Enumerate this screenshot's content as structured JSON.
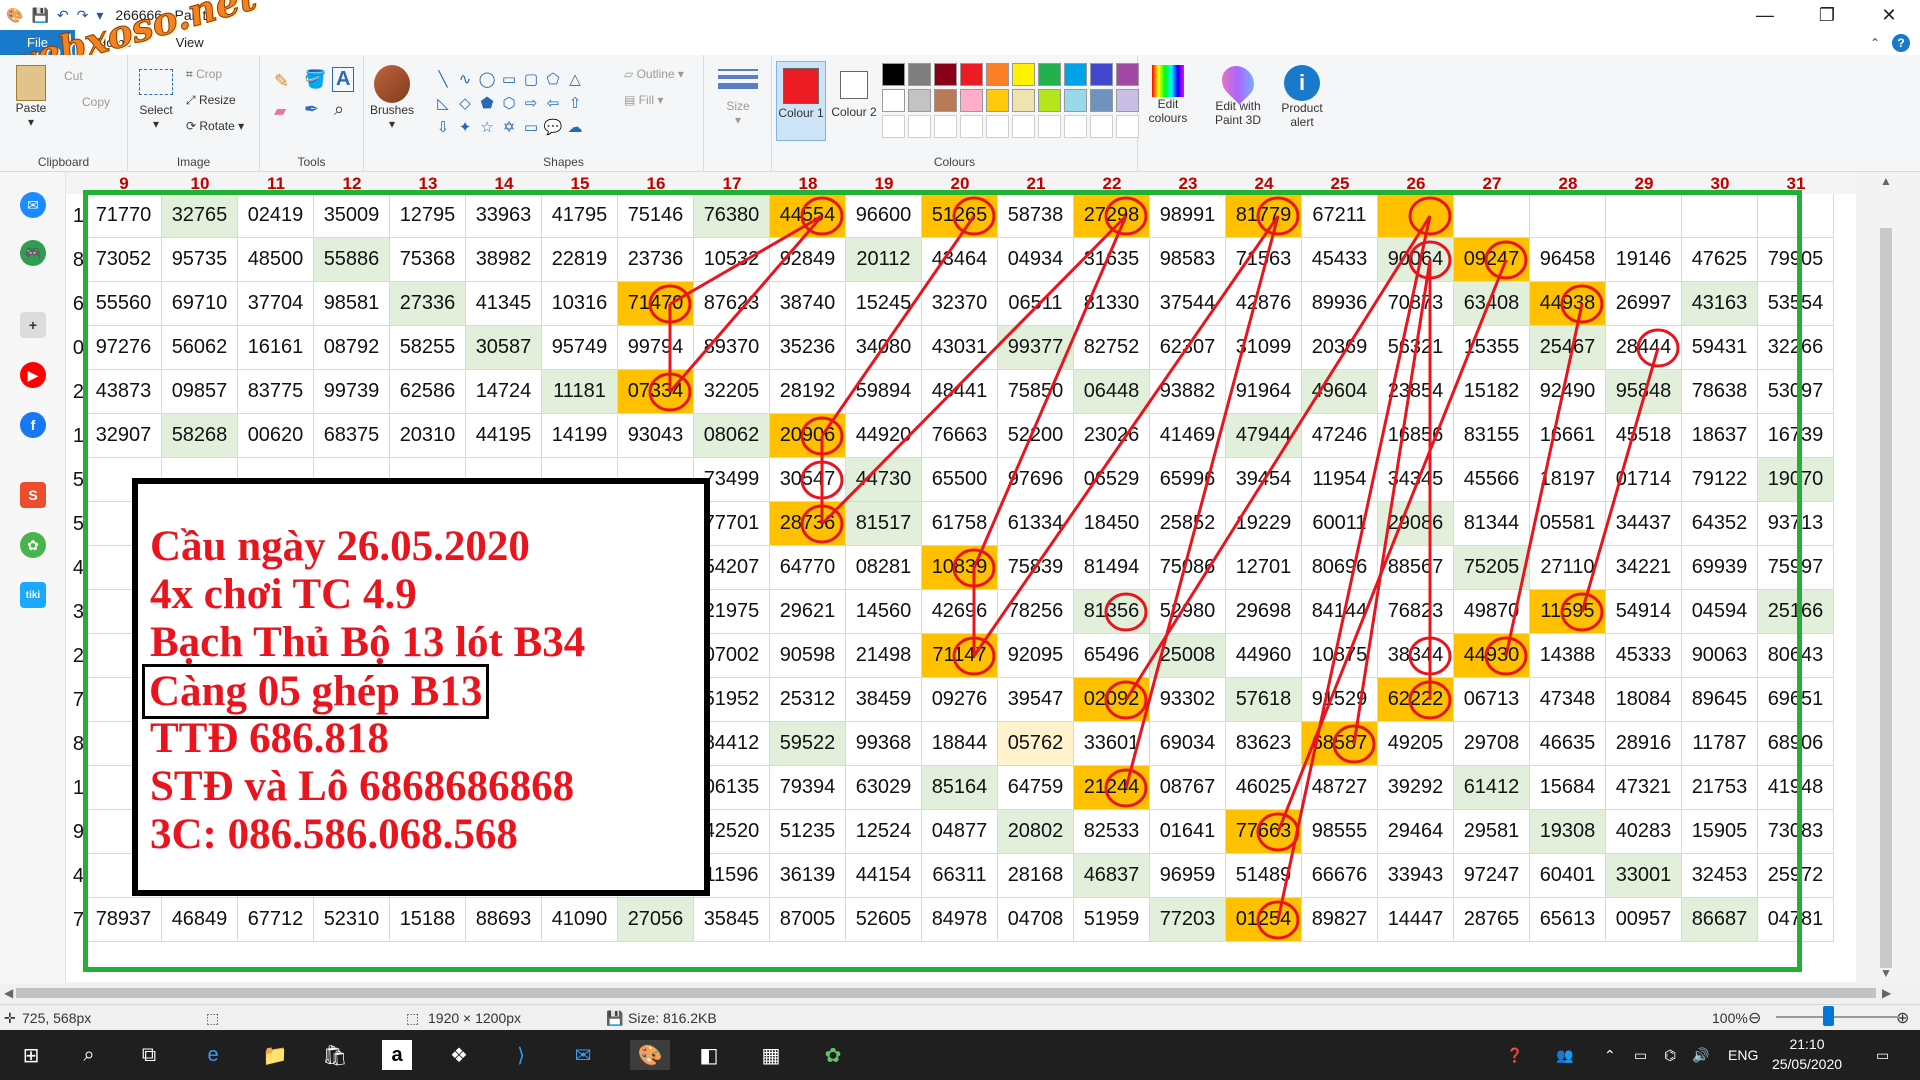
{
  "window": {
    "title": "266666 - Paint",
    "controls": [
      "—",
      "❐",
      "✕"
    ]
  },
  "tabs": [
    {
      "label": "File"
    },
    {
      "label": "Home"
    },
    {
      "label": "View"
    }
  ],
  "ribbon": {
    "clipboard": {
      "paste": "Paste",
      "cut": "Cut",
      "copy": "Copy",
      "label": "Clipboard"
    },
    "image": {
      "select": "Select",
      "crop": "Crop",
      "resize": "Resize",
      "rotate": "Rotate",
      "label": "Image"
    },
    "tools": {
      "label": "Tools"
    },
    "brushes": "Brushes",
    "shapes": {
      "outline": "Outline",
      "fill": "Fill",
      "label": "Shapes"
    },
    "size": "Size",
    "colour1": "Colour 1",
    "colour2": "Colour 2",
    "colours_label": "Colours",
    "edit_colours": "Edit colours",
    "edit_paint3d": "Edit with Paint 3D",
    "product_alert": "Product alert",
    "palette_row1": [
      "#000000",
      "#7f7f7f",
      "#880015",
      "#ed1c24",
      "#ff7f27",
      "#fff200",
      "#22b14c",
      "#00a2e8",
      "#3f48cc",
      "#a349a4"
    ],
    "palette_row2": [
      "#ffffff",
      "#c3c3c3",
      "#b97a57",
      "#ffaec9",
      "#ffc90e",
      "#efe4b0",
      "#b5e61d",
      "#99d9ea",
      "#7092be",
      "#c8bfe7"
    ],
    "colour1_value": "#ed1c24",
    "colour2_value": "#ffffff"
  },
  "watermark": "webxoso.net",
  "columns": [
    "9",
    "10",
    "11",
    "12",
    "13",
    "14",
    "15",
    "16",
    "17",
    "18",
    "19",
    "20",
    "21",
    "22",
    "23",
    "24",
    "25",
    "26",
    "27",
    "28",
    "29",
    "30",
    "31"
  ],
  "row_leads": [
    "1",
    "8",
    "6",
    "0",
    "2",
    "1",
    "5",
    "5",
    "4",
    "3",
    "2",
    "7",
    "8",
    "1",
    "9",
    "4",
    "7"
  ],
  "rows": [
    [
      "71770",
      "32765",
      "02419",
      "35009",
      "12795",
      "33963",
      "41795",
      "75146",
      "76380",
      "44554",
      "96600",
      "51265",
      "58738",
      "27298",
      "98991",
      "81779",
      "67211",
      "",
      "",
      "",
      "",
      "",
      ""
    ],
    [
      "73052",
      "95735",
      "48500",
      "55886",
      "75368",
      "38982",
      "22819",
      "23736",
      "10532",
      "92849",
      "20112",
      "43464",
      "04934",
      "31635",
      "98583",
      "71563",
      "45433",
      "90064",
      "09247",
      "96458",
      "19146",
      "47625",
      "79905"
    ],
    [
      "55560",
      "69710",
      "37704",
      "98581",
      "27336",
      "41345",
      "10316",
      "71470",
      "87623",
      "38740",
      "15245",
      "32370",
      "06511",
      "81330",
      "37544",
      "42876",
      "89936",
      "70873",
      "63408",
      "44938",
      "26997",
      "43163",
      "53554"
    ],
    [
      "97276",
      "56062",
      "16161",
      "08792",
      "58255",
      "30587",
      "95749",
      "99794",
      "89370",
      "35236",
      "34080",
      "43031",
      "99377",
      "82752",
      "62307",
      "31099",
      "20369",
      "56321",
      "15355",
      "25467",
      "28444",
      "59431",
      "32266"
    ],
    [
      "43873",
      "09857",
      "83775",
      "99739",
      "62586",
      "14724",
      "11181",
      "07334",
      "32205",
      "28192",
      "59894",
      "48441",
      "75850",
      "06448",
      "93882",
      "91964",
      "49604",
      "23854",
      "15182",
      "92490",
      "95848",
      "78638",
      "53097"
    ],
    [
      "32907",
      "58268",
      "00620",
      "68375",
      "20310",
      "44195",
      "14199",
      "93043",
      "08062",
      "20906",
      "44920",
      "76663",
      "52200",
      "23026",
      "41469",
      "47944",
      "47246",
      "16856",
      "83155",
      "16661",
      "45518",
      "18637",
      "16739"
    ],
    [
      "",
      "",
      "",
      "",
      "",
      "",
      "",
      "",
      "73499",
      "30547",
      "44730",
      "65500",
      "97696",
      "06529",
      "65996",
      "39454",
      "11954",
      "34345",
      "45566",
      "18197",
      "01714",
      "79122",
      "19070"
    ],
    [
      "",
      "",
      "",
      "",
      "",
      "",
      "",
      "",
      "77701",
      "28736",
      "81517",
      "61758",
      "61334",
      "18450",
      "25852",
      "19229",
      "60011",
      "29086",
      "81344",
      "05581",
      "34437",
      "64352",
      "93713"
    ],
    [
      "",
      "",
      "",
      "",
      "",
      "",
      "",
      "",
      "54207",
      "64770",
      "08281",
      "10839",
      "75839",
      "81494",
      "75086",
      "12701",
      "80696",
      "88567",
      "75205",
      "27110",
      "34221",
      "69939",
      "75997"
    ],
    [
      "",
      "",
      "",
      "",
      "",
      "",
      "",
      "",
      "21975",
      "29621",
      "14560",
      "42696",
      "78256",
      "81356",
      "52980",
      "29698",
      "84144",
      "76823",
      "49870",
      "11595",
      "54914",
      "04594",
      "25166"
    ],
    [
      "",
      "",
      "",
      "",
      "",
      "",
      "",
      "",
      "07002",
      "90598",
      "21498",
      "71147",
      "92095",
      "65496",
      "25008",
      "44960",
      "10875",
      "38344",
      "44930",
      "14388",
      "45333",
      "90063",
      "80643"
    ],
    [
      "",
      "",
      "",
      "",
      "",
      "",
      "",
      "",
      "51952",
      "25312",
      "38459",
      "09276",
      "39547",
      "02092",
      "93302",
      "57618",
      "91529",
      "62222",
      "06713",
      "47348",
      "18084",
      "89645",
      "69651"
    ],
    [
      "",
      "",
      "",
      "",
      "",
      "",
      "",
      "",
      "84412",
      "59522",
      "99368",
      "18844",
      "05762",
      "33601",
      "69034",
      "83623",
      "68587",
      "49205",
      "29708",
      "46635",
      "28916",
      "11787",
      "68906"
    ],
    [
      "",
      "",
      "",
      "",
      "",
      "",
      "",
      "",
      "06135",
      "79394",
      "63029",
      "85164",
      "64759",
      "21244",
      "08767",
      "46025",
      "48727",
      "39292",
      "61412",
      "15684",
      "47321",
      "21753",
      "41948"
    ],
    [
      "",
      "",
      "",
      "",
      "",
      "",
      "",
      "",
      "42520",
      "51235",
      "12524",
      "04877",
      "20802",
      "82533",
      "01641",
      "77663",
      "98555",
      "29464",
      "29581",
      "19308",
      "40283",
      "15905",
      "73083"
    ],
    [
      "",
      "",
      "",
      "",
      "",
      "",
      "",
      "",
      "11596",
      "36139",
      "44154",
      "66311",
      "28168",
      "46837",
      "96959",
      "51489",
      "66676",
      "33943",
      "97247",
      "60401",
      "33001",
      "32453",
      "25972"
    ],
    [
      "78937",
      "46849",
      "67712",
      "52310",
      "15188",
      "88693",
      "41090",
      "27056",
      "35845",
      "87005",
      "52605",
      "84978",
      "04708",
      "51959",
      "77203",
      "01254",
      "89827",
      "14447",
      "28765",
      "65613",
      "00957",
      "86687",
      "04781"
    ]
  ],
  "note": {
    "lines": [
      "Cầu ngày 26.05.2020",
      "4x chơi TC 4.9",
      "Bạch Thủ Bộ 13 lót B34",
      "Càng 05 ghép B13",
      "TTĐ 686.818",
      "STĐ và Lô 6868686868",
      "3C: 086.586.068.568"
    ]
  },
  "status": {
    "cursor": "725, 568px",
    "dimensions": "1920 × 1200px",
    "size": "Size: 816.2KB",
    "zoom": "100%"
  },
  "taskbar": {
    "lang": "ENG",
    "time": "21:10",
    "date": "25/05/2020"
  }
}
